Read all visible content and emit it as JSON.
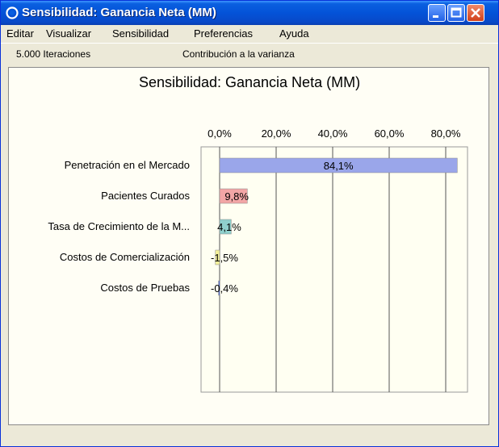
{
  "window": {
    "title": "Sensibilidad: Ganancia Neta (MM)",
    "titlebar_color": "#0453d8"
  },
  "menu": {
    "items": [
      "Editar",
      "Visualizar",
      "Sensibilidad",
      "Preferencias",
      "Ayuda"
    ]
  },
  "status": {
    "iterations": "5.000 Iteraciones",
    "view": "Contribución a la varianza"
  },
  "chart_data": {
    "type": "bar",
    "orientation": "horizontal",
    "title": "Sensibilidad: Ganancia Neta (MM)",
    "xlim": [
      -0.5,
      84.5
    ],
    "xticks": [
      "0,0%",
      "20,0%",
      "40,0%",
      "60,0%",
      "80,0%"
    ],
    "xtick_values": [
      0,
      20,
      40,
      60,
      80
    ],
    "grid": true,
    "categories": [
      "Penetración en el Mercado",
      "Pacientes Curados",
      "Tasa de Crecimiento de la M...",
      "Costos de Comercialización",
      "Costos de Pruebas"
    ],
    "values": [
      84.1,
      9.8,
      4.1,
      -1.5,
      -0.4
    ],
    "labels": [
      "84,1%",
      "9,8%",
      "4,1%",
      "-1,5%",
      "-0,4%"
    ],
    "colors": [
      "#9aa6ea",
      "#f2a6a6",
      "#8fd0cc",
      "#f3f09a",
      "#4d6bd6"
    ]
  }
}
